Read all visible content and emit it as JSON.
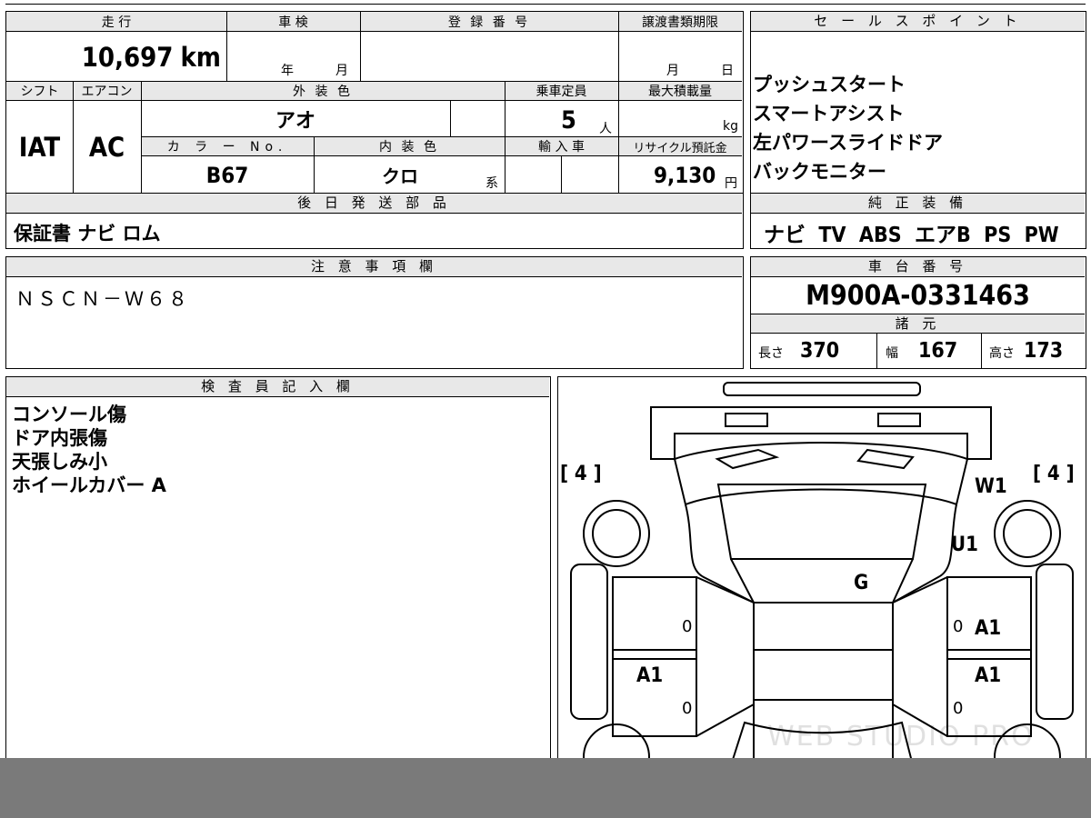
{
  "top_table": {
    "mileage_label": "走 行",
    "mileage": "10,697",
    "mileage_unit": "km",
    "inspection_label": "車 検",
    "inspection_year": "年",
    "inspection_month": "月",
    "reg_no_label": "登 録 番 号",
    "transfer_label": "譲渡書類期限",
    "transfer_month": "月",
    "transfer_day": "日",
    "shift_label": "シフト",
    "shift": "IAT",
    "ac_label": "エアコン",
    "ac": "AC",
    "ext_color_label": "外 装 色",
    "ext_color": "アオ",
    "capacity_label": "乗車定員",
    "capacity": "5",
    "capacity_unit": "人",
    "max_load_label": "最大積載量",
    "max_load_unit": "kg",
    "color_no_label": "カ ラ ー No.",
    "color_no": "B67",
    "int_color_label": "内 装 色",
    "int_color": "クロ",
    "int_color_unit": "系",
    "import_label": "輸 入 車",
    "recycle_label": "リサイクル預託金",
    "recycle": "9,130",
    "recycle_unit": "円"
  },
  "later_parts": {
    "label": "後 日 発 送 部 品",
    "value": "保証書 ナビ ロム"
  },
  "notes": {
    "label": "注 意 事 項 欄",
    "value": "ＮＳＣＮ－Ｗ６８"
  },
  "sales_points": {
    "label": "セ ー ル ス ポ イ ン ト",
    "items": [
      "プッシュスタート",
      "スマートアシスト",
      "左パワースライドドア",
      "バックモニター"
    ]
  },
  "factory_equipment": {
    "label": "純 正 装 備",
    "value": "ナビ  TV  ABS  エアB  PS  PW"
  },
  "chassis": {
    "label": "車 台 番 号",
    "value": "M900A-0331463"
  },
  "specs": {
    "label": "諸 元",
    "length_label": "長さ",
    "length": "370",
    "width_label": "幅",
    "width": "167",
    "height_label": "高さ",
    "height": "173"
  },
  "inspector": {
    "label": "検 査 員 記 入 欄",
    "items": [
      "コンソール傷",
      "ドア内張傷",
      "天張しみ小",
      "ホイールカバー A"
    ]
  },
  "diagram": {
    "tire_left": "[ 4 ]",
    "tire_right": "[ 4 ]",
    "marks": [
      {
        "id": "w1",
        "text": "W1"
      },
      {
        "id": "u1",
        "text": "U1"
      },
      {
        "id": "g",
        "text": "G"
      },
      {
        "id": "a1-right-front",
        "text": "A1"
      },
      {
        "id": "a1-left-rear",
        "text": "A1"
      },
      {
        "id": "a1-right-rear",
        "text": "A1"
      }
    ],
    "zero": "0",
    "watermark": "WEB STUDIO PRO"
  }
}
